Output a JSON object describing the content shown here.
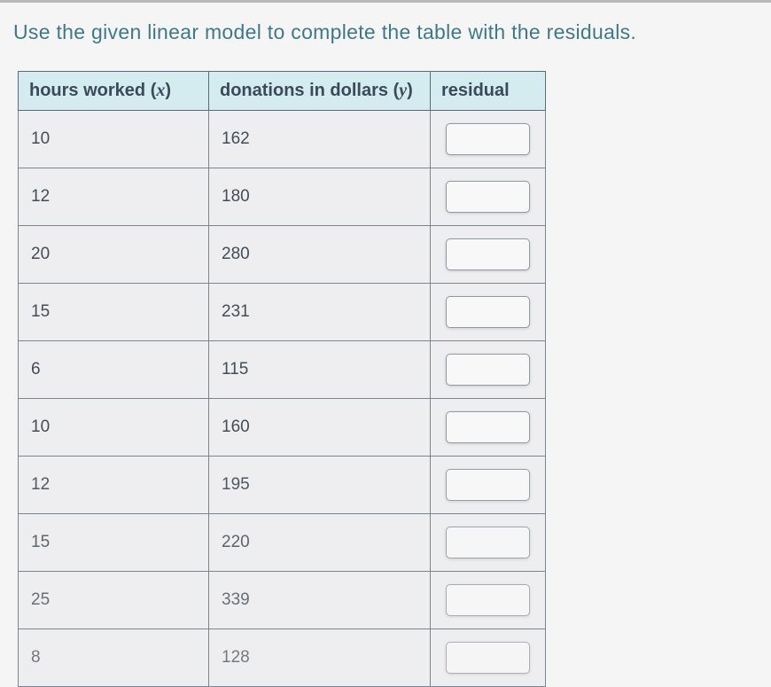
{
  "instruction": "Use the given linear model to complete the table with the residuals.",
  "headers": {
    "x_label": "hours worked (",
    "x_var": "x",
    "x_close": ")",
    "y_label": "donations in dollars (",
    "y_var": "y",
    "y_close": ")",
    "residual_label": "residual"
  },
  "rows": [
    {
      "x": "10",
      "y": "162",
      "residual": ""
    },
    {
      "x": "12",
      "y": "180",
      "residual": ""
    },
    {
      "x": "20",
      "y": "280",
      "residual": ""
    },
    {
      "x": "15",
      "y": "231",
      "residual": ""
    },
    {
      "x": "6",
      "y": "115",
      "residual": ""
    },
    {
      "x": "10",
      "y": "160",
      "residual": ""
    },
    {
      "x": "12",
      "y": "195",
      "residual": ""
    },
    {
      "x": "15",
      "y": "220",
      "residual": ""
    },
    {
      "x": "25",
      "y": "339",
      "residual": ""
    },
    {
      "x": "8",
      "y": "128",
      "residual": ""
    }
  ]
}
